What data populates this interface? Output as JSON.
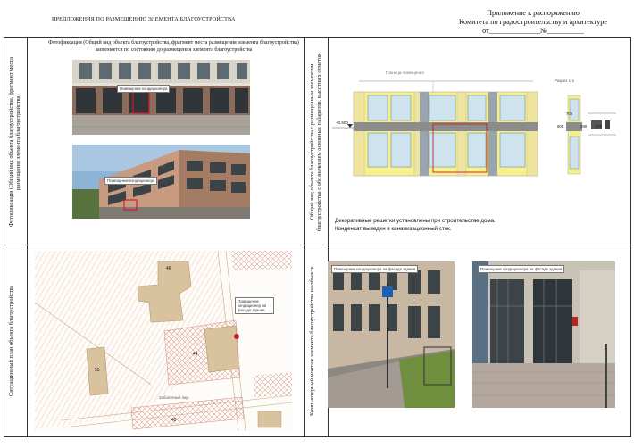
{
  "header": {
    "title": "ПРЕДЛОЖЕНИЯ ПО РАЗМЕЩЕНИЮ ЭЛЕМЕНТА БЛАГОУСТРОЙСТВА",
    "appendix_lines": [
      "Приложение к распоряжению",
      "Комитета по градостроительству и архитектуре",
      "от______________№__________"
    ]
  },
  "photo_panel": {
    "side_label": "Фотофиксация (Общий вид объекта благоустройства, фрагмент места размещения элемента благоустройства)",
    "caption": "Фотофиксация (Общий вид объекта благоустройства, фрагмент места размещения элемента благоустройства) заполняется по состоянию до размещения элемента благоустройства",
    "callout_1": "Помещение кондиционера",
    "callout_2": "Помещение кондиционера"
  },
  "facade_panel": {
    "side_label": "Общий вид объекта благоустройства с размещенным элементом благоустройства с обозначением основных габаритов, высотных отметок",
    "label_top": "Граница помещения",
    "label_section": "Разрез 1-1",
    "elev_label": "+2.500",
    "dims": [
      "700",
      "600",
      "290",
      "270"
    ],
    "note_lines": [
      "Декоративные решетки установлены при строительстве дома.",
      "Конденсат выведен в канализационный сток."
    ]
  },
  "plan_panel": {
    "side_label": "Ситуационный план объекта благоустройства",
    "building_numbers": [
      "46",
      "44",
      "55",
      "42"
    ],
    "street_name": "Заболотный пер.",
    "callout": "Помещение кондиционер на фасаде здания"
  },
  "montage_panel": {
    "side_label": "Компьютерный монтаж элемента благоустройства на объекте",
    "callout_1": "Помещение кондиционера на фасаде здания",
    "callout_2": "Помещение кондиционера на фасаде здания"
  }
}
